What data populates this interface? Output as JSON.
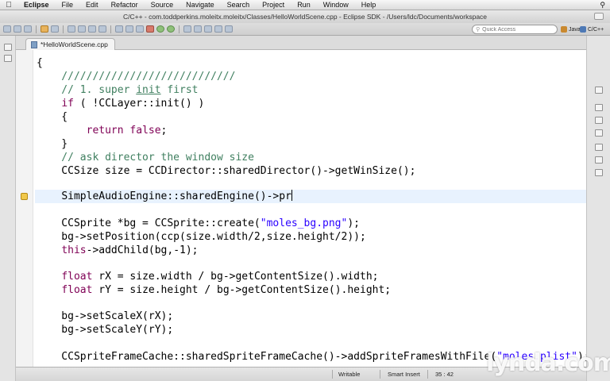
{
  "menubar": {
    "app": "Eclipse",
    "items": [
      "File",
      "Edit",
      "Refactor",
      "Source",
      "Navigate",
      "Search",
      "Project",
      "Run",
      "Window",
      "Help"
    ]
  },
  "window": {
    "title": "C/C++ - com.toddperkins.moleitx.moleitx/Classes/HelloWorldScene.cpp - Eclipse SDK - /Users/ldc/Documents/workspace"
  },
  "toolbar": {
    "quick_access_placeholder": "Quick Access",
    "perspectives": [
      {
        "label": "Java",
        "color": "#c9892f"
      },
      {
        "label": "C/C++",
        "color": "#4e79b5"
      }
    ]
  },
  "editor": {
    "tab_label": "*HelloWorldScene.cpp",
    "current_line": "SimpleAudioEngine::sharedEngine()->pr",
    "lines": {
      "l1": "{",
      "l2": "    ////////////////////////////",
      "l3a": "    // 1. super ",
      "l3b": "init",
      "l3c": " first",
      "l4a": "    ",
      "l4b": "if",
      "l4c": " ( !CCLayer::init() )",
      "l5": "    {",
      "l6a": "        ",
      "l6b": "return false",
      "l6c": ";",
      "l7": "    }",
      "l8": "    // ask director the window size",
      "l9": "    CCSize size = CCDirector::sharedDirector()->getWinSize();",
      "l11": "    ",
      "l13a": "    CCSprite *bg = CCSprite::create(",
      "l13b": "\"moles_bg.png\"",
      "l13c": ");",
      "l14": "    bg->setPosition(ccp(size.width/2,size.height/2));",
      "l15a": "    ",
      "l15b": "this",
      "l15c": "->addChild(bg,-1);",
      "l17a": "    ",
      "l17b": "float",
      "l17c": " rX = size.width / bg->getContentSize().width;",
      "l18a": "    ",
      "l18b": "float",
      "l18c": " rY = size.height / bg->getContentSize().height;",
      "l20": "    bg->setScaleX(rX);",
      "l21": "    bg->setScaleY(rY);",
      "l23a": "    CCSpriteFrameCache::sharedSpriteFrameCache()->addSpriteFramesWithFile(",
      "l23b": "\"moles.plist\"",
      "l23c": ");"
    }
  },
  "statusbar": {
    "mode": "Writable",
    "insert": "Smart Insert",
    "position": "35 : 42"
  },
  "watermark": "lynda.com",
  "colors": {
    "comment": "#3f7f5f",
    "keyword": "#7f0055",
    "string": "#2a00ff",
    "current_line_bg": "#e8f2fe"
  }
}
